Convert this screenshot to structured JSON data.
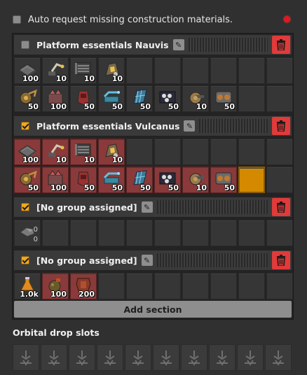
{
  "window": {
    "auto_request_label": "Auto request missing construction materials.",
    "auto_request_checked": false
  },
  "sections": [
    {
      "title": "Platform essentials Nauvis",
      "checked": false,
      "rows": [
        [
          {
            "icon": "space-platform-foundation-icon",
            "count": "100"
          },
          {
            "icon": "inserter-icon",
            "count": "10"
          },
          {
            "icon": "transport-belt-icon",
            "count": "10"
          },
          {
            "icon": "electric-furnace-icon",
            "count": "10"
          },
          null,
          null,
          null,
          null,
          null,
          null
        ],
        [
          {
            "icon": "asteroid-collector-icon",
            "count": "50"
          },
          {
            "icon": "crusher-icon",
            "count": "100"
          },
          {
            "icon": "thruster-icon",
            "count": "50"
          },
          {
            "icon": "chemical-plant-icon",
            "count": "50"
          },
          {
            "icon": "solar-panel-icon",
            "count": "50"
          },
          {
            "icon": "assembling-machine-icon",
            "count": "50"
          },
          {
            "icon": "gun-turret-icon",
            "count": "10"
          },
          {
            "icon": "cargo-bay-icon",
            "count": "50"
          },
          null,
          null
        ]
      ]
    },
    {
      "title": "Platform essentials Vulcanus",
      "checked": true,
      "rows": [
        [
          {
            "icon": "space-platform-foundation-icon",
            "count": "100",
            "red": true
          },
          {
            "icon": "inserter-icon",
            "count": "10",
            "red": true
          },
          {
            "icon": "transport-belt-icon",
            "count": "10",
            "red": true
          },
          {
            "icon": "electric-furnace-icon",
            "count": "10",
            "red": true
          },
          null,
          null,
          null,
          null,
          null,
          null
        ],
        [
          {
            "icon": "asteroid-collector-icon",
            "count": "50",
            "red": true
          },
          {
            "icon": "crusher-icon",
            "count": "100",
            "red": true
          },
          {
            "icon": "thruster-icon",
            "count": "50",
            "red": true
          },
          {
            "icon": "chemical-plant-icon",
            "count": "50",
            "red": true
          },
          {
            "icon": "solar-panel-icon",
            "count": "50",
            "red": true
          },
          {
            "icon": "assembling-machine-icon",
            "count": "50",
            "red": true
          },
          {
            "icon": "gun-turret-icon",
            "count": "10",
            "red": true
          },
          {
            "icon": "cargo-bay-icon",
            "count": "50",
            "red": true
          },
          {
            "icon": "empty-selected-slot",
            "count": "",
            "gold": true
          },
          null
        ]
      ]
    },
    {
      "title": "[No group assigned]",
      "checked": true,
      "rows": [
        [
          {
            "icon": "stone-icon",
            "count_top": "0",
            "count_bottom": "0"
          },
          null,
          null,
          null,
          null,
          null,
          null,
          null,
          null,
          null
        ]
      ]
    },
    {
      "title": "[No group assigned]",
      "checked": true,
      "rows": [
        [
          {
            "icon": "science-flask-icon",
            "count": "1.0k"
          },
          {
            "icon": "grenade-icon",
            "count": "100",
            "red": true
          },
          {
            "icon": "armor-icon",
            "count": "200",
            "red": true
          },
          null,
          null,
          null,
          null,
          null,
          null,
          null
        ]
      ]
    }
  ],
  "add_section_label": "Add section",
  "orbital": {
    "title": "Orbital drop slots",
    "slot_count": 10
  },
  "colors": {
    "accent_orange": "#f0a81e",
    "delete_red": "#e03a3a",
    "missing_red": "#8a3a3a",
    "status_dot": "#e8141e"
  }
}
